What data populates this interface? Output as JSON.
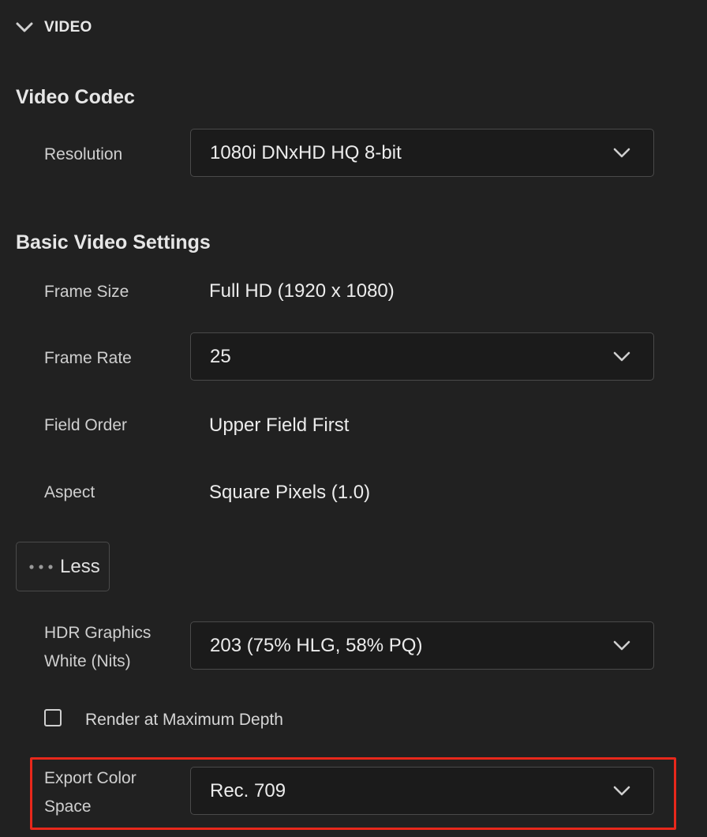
{
  "section": {
    "title": "VIDEO",
    "expand_icon": "chevron-down-icon"
  },
  "video_codec": {
    "title": "Video Codec",
    "resolution_label": "Resolution",
    "resolution_value": "1080i DNxHD HQ 8-bit"
  },
  "basic_video_settings": {
    "title": "Basic Video Settings",
    "frame_size_label": "Frame Size",
    "frame_size_value": "Full HD (1920 x 1080)",
    "frame_rate_label": "Frame Rate",
    "frame_rate_value": "25",
    "field_order_label": "Field Order",
    "field_order_value": "Upper Field First",
    "aspect_label": "Aspect",
    "aspect_value": "Square Pixels (1.0)"
  },
  "less_button": {
    "label": "Less",
    "icon": "more-dots-icon"
  },
  "advanced": {
    "hdr_label_line1": "HDR Graphics",
    "hdr_label_line2": "White (Nits)",
    "hdr_value": "203 (75% HLG, 58% PQ)",
    "render_max_depth_label": "Render at Maximum Depth",
    "render_max_depth_checked": false,
    "export_color_label_line1": "Export Color",
    "export_color_label_line2": "Space",
    "export_color_value": "Rec. 709"
  },
  "colors": {
    "background": "#212121",
    "dropdown_bg": "#1b1b1b",
    "border": "#4a4a4a",
    "highlight": "#e8281b"
  }
}
